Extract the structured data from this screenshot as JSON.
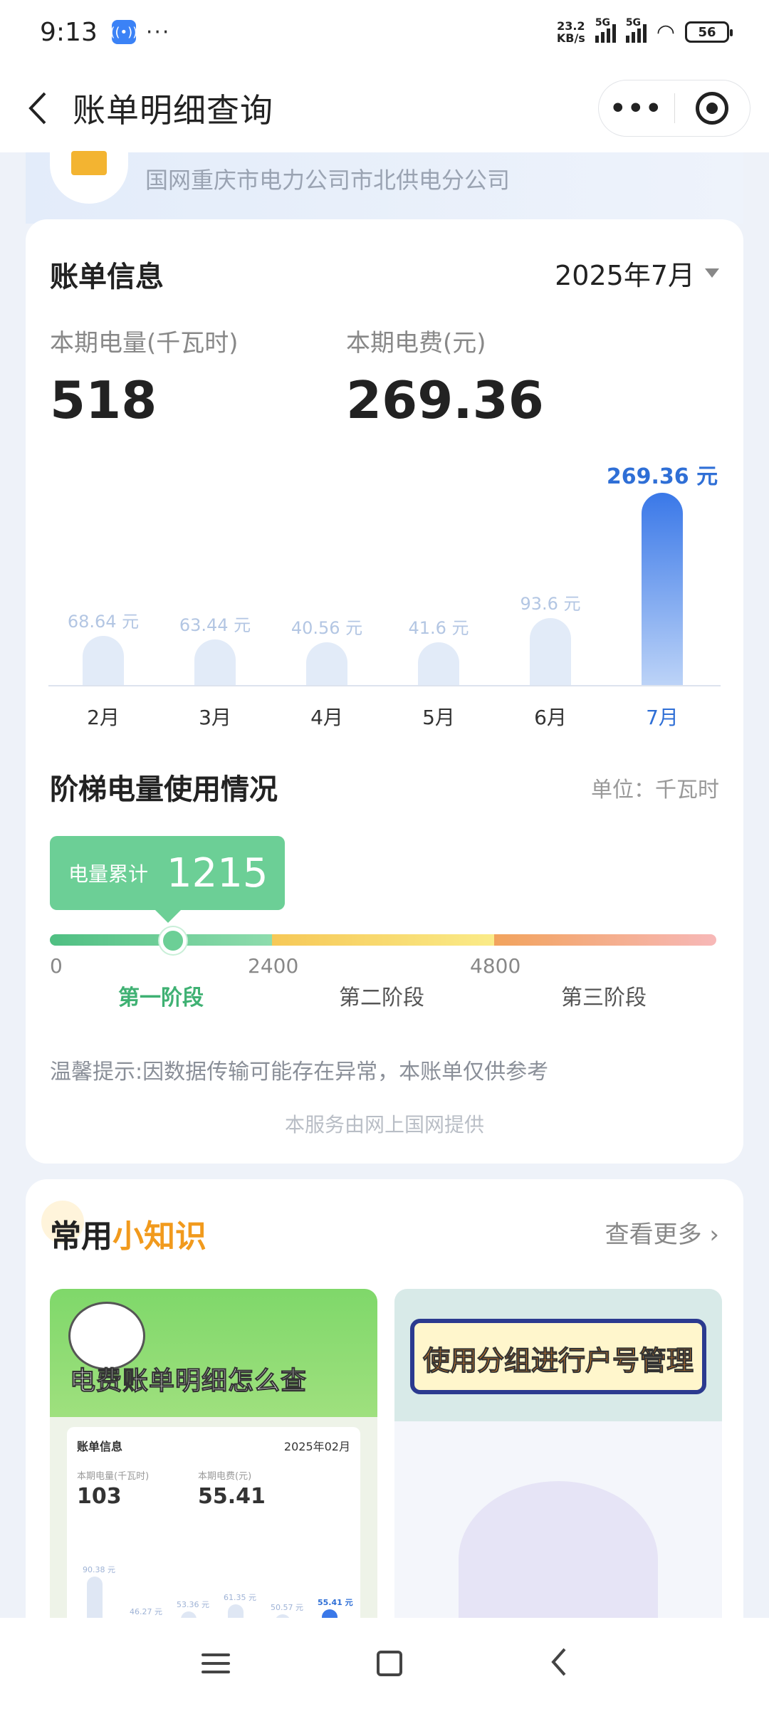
{
  "status_bar": {
    "time": "9:13",
    "speed_value": "23.2",
    "speed_unit": "KB/s",
    "network_1": "5G",
    "network_2": "5G",
    "battery": "56"
  },
  "title_bar": {
    "title": "账单明细查询",
    "more_label": "•••"
  },
  "account": {
    "org_name": "国网重庆市电力公司市北供电分公司"
  },
  "bill": {
    "heading": "账单信息",
    "month": "2025年7月",
    "usage_label": "本期电量(千瓦时)",
    "usage_value": "518",
    "fee_label": "本期电费(元)",
    "fee_value": "269.36"
  },
  "chart_data": {
    "type": "bar",
    "categories": [
      "2月",
      "3月",
      "4月",
      "5月",
      "6月",
      "7月"
    ],
    "values": [
      68.64,
      63.44,
      40.56,
      41.6,
      93.6,
      269.36
    ],
    "value_labels": [
      "68.64 元",
      "63.44 元",
      "40.56 元",
      "41.6 元",
      "93.6 元",
      "269.36 元"
    ],
    "highlight_index": 5,
    "colors": {
      "bar": "#e2ebf8",
      "highlight": "#3a78e8",
      "label": "#b3c6e3",
      "highlight_label": "#2f6fd6"
    }
  },
  "tier": {
    "heading": "阶梯电量使用情况",
    "unit": "单位：千瓦时",
    "cumulative_label": "电量累计",
    "cumulative_value": "1215",
    "ticks": [
      "0",
      "2400",
      "4800"
    ],
    "stages": [
      "第一阶段",
      "第二阶段",
      "第三阶段"
    ],
    "colors": {
      "stage1": "#6ccf96",
      "stage2": "#f7d26b",
      "stage3": "#f4a98e"
    }
  },
  "notice": {
    "tip": "温馨提示:因数据传输可能存在异常，本账单仅供参考",
    "provider": "本服务由网上国网提供"
  },
  "knowledge": {
    "heading_part1": "常用",
    "heading_part2": "小知识",
    "more_label": "查看更多",
    "cards": [
      {
        "title": "电费账单明细怎么查",
        "mini_heading": "账单信息",
        "mini_month": "2025年02月",
        "mini_usage_label": "本期电量(千瓦时)",
        "mini_usage_value": "103",
        "mini_fee_label": "本期电费(元)",
        "mini_fee_value": "55.41",
        "mini_values": [
          "90.38 元",
          "46.27 元",
          "53.36 元",
          "61.35 元",
          "50.57 元",
          "55.41 元"
        ]
      },
      {
        "title": "使用分组进行户号管理"
      }
    ]
  },
  "nav_bar": {
    "icons": [
      "menu-icon",
      "home-icon",
      "back-icon"
    ]
  }
}
